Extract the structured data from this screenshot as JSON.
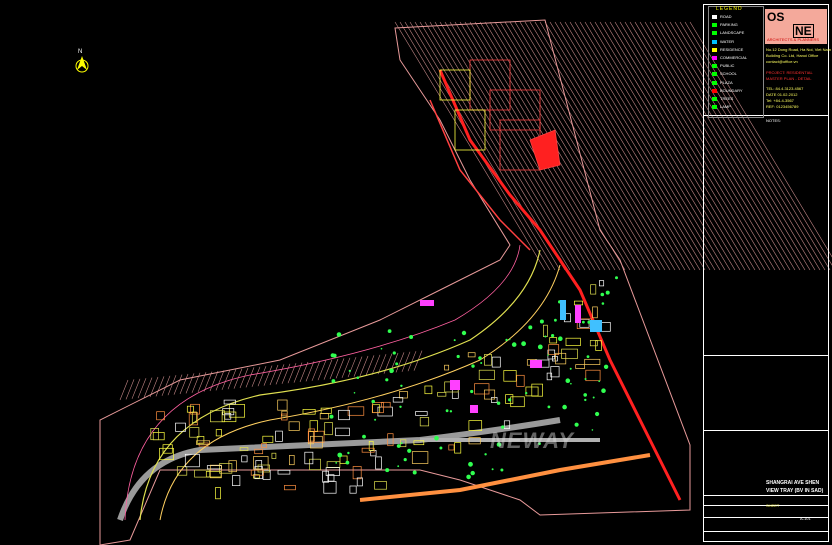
{
  "north_label": "N",
  "legend": {
    "title": "LEGEND",
    "items": [
      {
        "label": "ROAD",
        "color": "#ffffff"
      },
      {
        "label": "PARKING",
        "color": "#00ff00"
      },
      {
        "label": "LANDSCAPE",
        "color": "#00ff00"
      },
      {
        "label": "WATER",
        "color": "#00c0ff"
      },
      {
        "label": "RESIDENCE",
        "color": "#ffff00"
      },
      {
        "label": "COMMERCIAL",
        "color": "#ff00ff"
      },
      {
        "label": "PUBLIC",
        "color": "#00ff00"
      },
      {
        "label": "SCHOOL",
        "color": "#00ff00"
      },
      {
        "label": "PLAZA",
        "color": "#00ff00"
      },
      {
        "label": "BOUNDARY",
        "color": "#ff0000"
      },
      {
        "label": "TREES",
        "color": "#00ff00"
      },
      {
        "label": "LAMP",
        "color": "#00ff00"
      }
    ]
  },
  "logo": {
    "os": "OS",
    "ne": "NE",
    "sub": "ARCHITECTS & PLANNERS"
  },
  "title_block": {
    "address": "No.12 Dong Road, Ha Noi, Viet Nam",
    "company_line": "Building Co. Ltd, Hanoi Office",
    "contact": "contact@office.vn",
    "project_red_1": "PROJECT: RESIDENTIAL",
    "project_red_2": "MASTER PLAN - DETAIL",
    "phone": "TEL: 84.4.3123.4567",
    "date": "DATE 01.02.2012",
    "scale_note": "Tel: +84-4-3567",
    "ref": "REF: 0123456789",
    "notes_label": "NOTES:",
    "drawing_title_1": "SHANGRAI AVE SHEN",
    "drawing_title_2": "VIEW TRAY (BV IN SAD)",
    "drawing_number": "A-101",
    "sheet_label": "SHEET"
  },
  "watermark": "NEWAY"
}
